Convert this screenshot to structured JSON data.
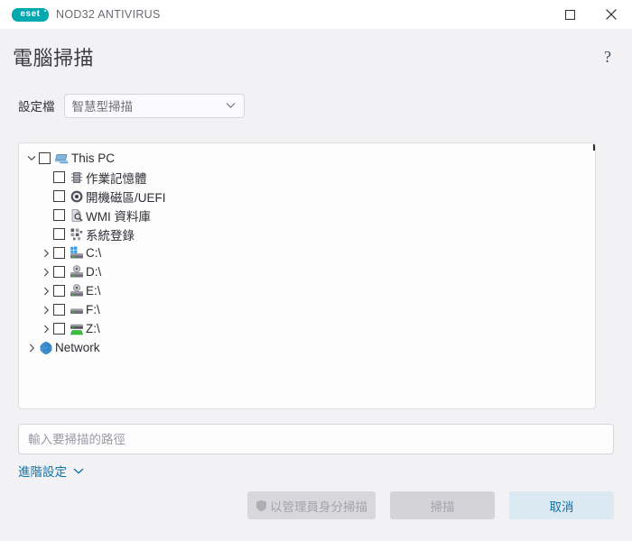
{
  "window": {
    "brand_name": "NOD32 ANTIVIRUS",
    "logo_text": "eset",
    "controls": [
      {
        "name": "maximize",
        "icon": "maximize-icon"
      },
      {
        "name": "close",
        "icon": "close-icon"
      }
    ]
  },
  "header": {
    "title": "電腦掃描",
    "help_glyph": "?"
  },
  "profile": {
    "label": "設定檔",
    "selected": "智慧型掃描"
  },
  "tree": {
    "items": [
      {
        "label": "This PC",
        "expander": "chevron-down",
        "checkbox": true,
        "checked": false,
        "icon": "computer-icon",
        "indent": 0
      },
      {
        "label": "作業記憶體",
        "expander": "none",
        "checkbox": true,
        "checked": false,
        "icon": "memory-icon",
        "indent": 1
      },
      {
        "label": "開機磁區/UEFI",
        "expander": "none",
        "checkbox": true,
        "checked": false,
        "icon": "disc-icon",
        "indent": 1
      },
      {
        "label": "WMI 資料庫",
        "expander": "none",
        "checkbox": true,
        "checked": false,
        "icon": "wmi-database-icon",
        "indent": 1
      },
      {
        "label": "系統登錄",
        "expander": "none",
        "checkbox": true,
        "checked": false,
        "icon": "registry-icon",
        "indent": 1
      },
      {
        "label": "C:\\",
        "expander": "chevron-right",
        "checkbox": true,
        "checked": false,
        "icon": "windows-drive-icon",
        "indent": 1
      },
      {
        "label": "D:\\",
        "expander": "chevron-right",
        "checkbox": true,
        "checked": false,
        "icon": "optical-drive-icon",
        "indent": 1
      },
      {
        "label": "E:\\",
        "expander": "chevron-right",
        "checkbox": true,
        "checked": false,
        "icon": "optical-drive-icon",
        "indent": 1
      },
      {
        "label": "F:\\",
        "expander": "chevron-right",
        "checkbox": true,
        "checked": false,
        "icon": "hard-drive-icon",
        "indent": 1
      },
      {
        "label": "Z:\\",
        "expander": "chevron-right",
        "checkbox": true,
        "checked": false,
        "icon": "network-drive-icon",
        "indent": 1
      },
      {
        "label": "Network",
        "expander": "chevron-right",
        "checkbox": false,
        "checked": false,
        "icon": "globe-icon",
        "indent": 0
      }
    ]
  },
  "path_field": {
    "value": "",
    "placeholder": "輸入要掃描的路徑"
  },
  "advanced": {
    "label": "進階設定",
    "icon": "chevron-down-icon"
  },
  "buttons": {
    "admin_scan": "以管理員身分掃描",
    "scan": "掃描",
    "cancel": "取消"
  },
  "colors": {
    "brand_teal": "#00a8b0",
    "accent_blue": "#1273a8",
    "body_bg": "#f2f2f5",
    "panel_bg": "#fdfdfe"
  }
}
